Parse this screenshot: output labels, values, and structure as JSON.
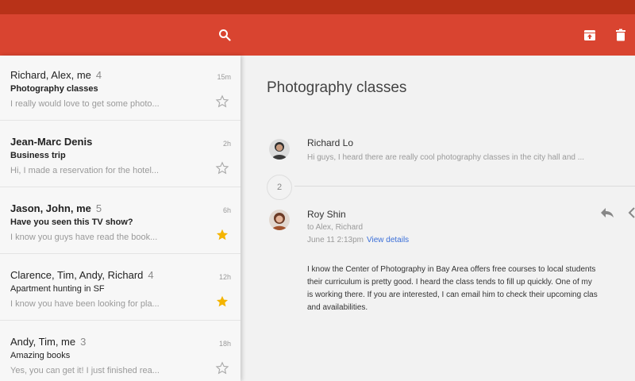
{
  "toolbar": {
    "search_icon": "search-icon",
    "archive_icon": "archive-icon",
    "delete_icon": "trash-icon",
    "colors": {
      "status_bar": "#b83218",
      "app_bar": "#d94430"
    }
  },
  "conversations": [
    {
      "sender": "Richard, Alex, me",
      "count": "4",
      "subject": "Photography classes",
      "snippet": "I really would love to get some photo...",
      "time": "15m",
      "starred": false,
      "unread": false
    },
    {
      "sender": "Jean-Marc Denis",
      "count": "",
      "subject": "Business trip",
      "snippet": "Hi, I made a reservation for the hotel...",
      "time": "2h",
      "starred": false,
      "unread": true
    },
    {
      "sender": "Jason, John, me",
      "count": "5",
      "subject": "Have you seen this TV show?",
      "snippet": "I know you guys have read the book...",
      "time": "6h",
      "starred": true,
      "unread": true
    },
    {
      "sender": "Clarence, Tim, Andy, Richard",
      "count": "4",
      "subject": "Apartment hunting in SF",
      "snippet": "I know you have been looking for pla...",
      "time": "12h",
      "starred": true,
      "unread": false
    },
    {
      "sender": "Andy, Tim, me",
      "count": "3",
      "subject": "Amazing books",
      "snippet": "Yes, you can get it! I just finished rea...",
      "time": "18h",
      "starred": false,
      "unread": false
    }
  ],
  "detail": {
    "title": "Photography classes",
    "first_message": {
      "sender": "Richard Lo",
      "snippet": "Hi guys, I heard there are really cool photography classes in the city hall and ..."
    },
    "collapsed_count": "2",
    "open_message": {
      "sender": "Roy Shin",
      "to": "to Alex, Richard",
      "date": "June 11 2:13pm",
      "view_details": "View details",
      "body_lines": [
        "I know the Center of Photography in Bay Area offers free courses to local students",
        "their curriculum is pretty good. I heard the class tends to fill up quickly. One of my",
        "is working there. If you are interested, I can email him to check their upcoming clas",
        "and availabilities."
      ]
    }
  }
}
